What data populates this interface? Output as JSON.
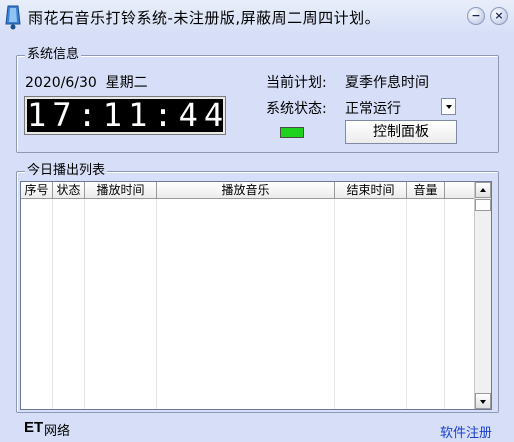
{
  "window": {
    "title": "雨花石音乐打铃系统-未注册版,屏蔽周二周四计划。",
    "minimize_label": "−",
    "close_label": "×"
  },
  "system_info": {
    "legend": "系统信息",
    "date": "2020/6/30  星期二",
    "clock": "17:11:44",
    "plan_label": "当前计划:",
    "plan_value": "夏季作息时间",
    "status_label": "系统状态:",
    "status_value": "正常运行",
    "control_button": "控制面板",
    "status_led_color": "#1fd21f"
  },
  "playlist": {
    "legend": "今日播出列表",
    "columns": [
      "序号",
      "状态",
      "播放时间",
      "播放音乐",
      "结束时间",
      "音量",
      ""
    ]
  },
  "footer": {
    "brand_et": "ET",
    "brand_net": "网络",
    "register_link": "软件注册"
  }
}
